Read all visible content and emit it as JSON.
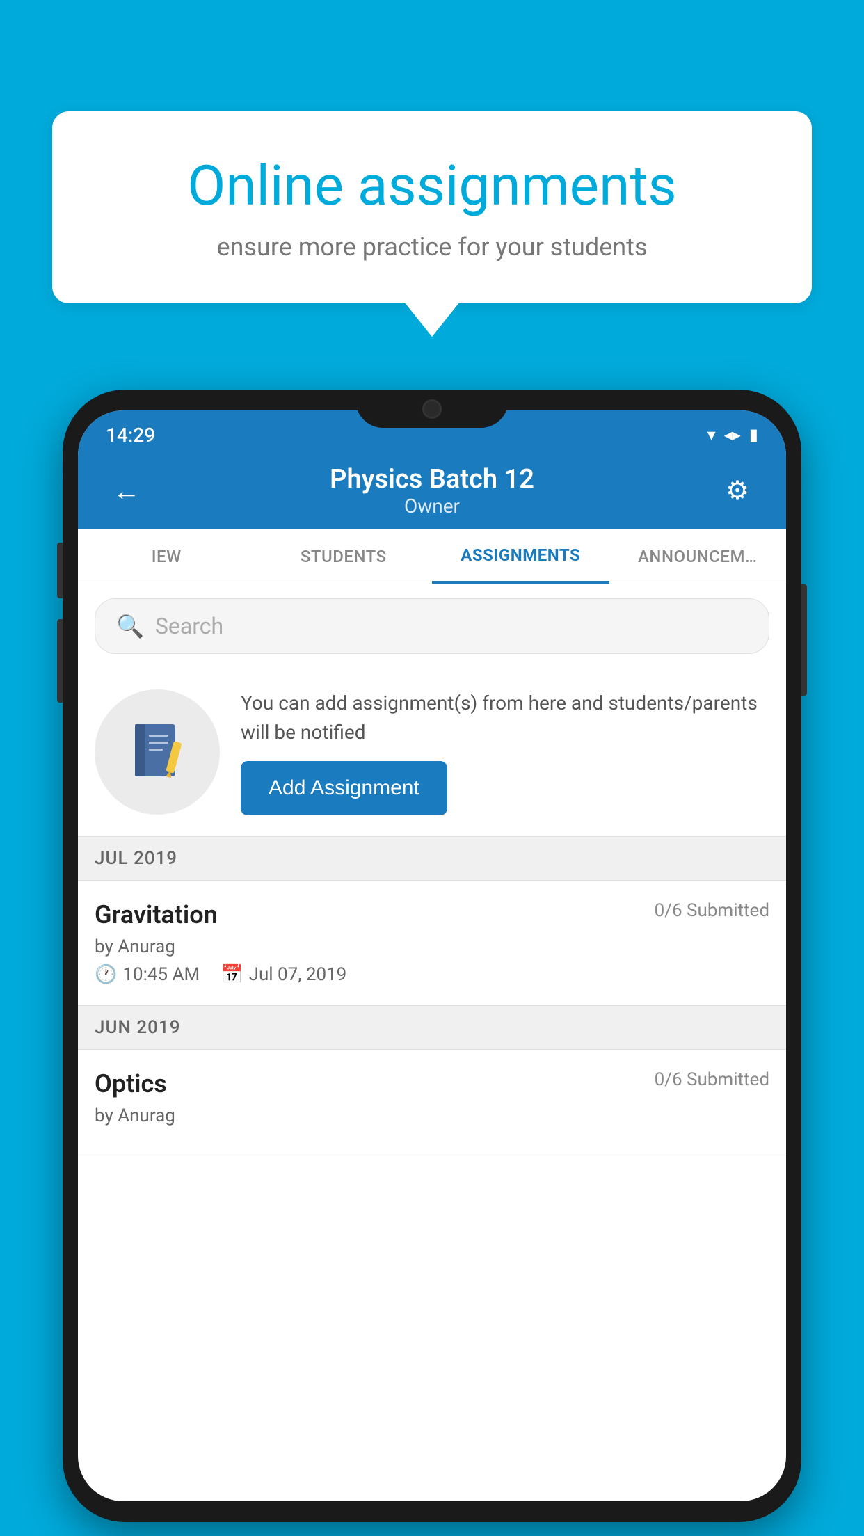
{
  "background_color": "#00AADB",
  "speech_bubble": {
    "title": "Online assignments",
    "subtitle": "ensure more practice for your students"
  },
  "status_bar": {
    "time": "14:29",
    "icons": [
      "wifi",
      "signal",
      "battery"
    ]
  },
  "header": {
    "title": "Physics Batch 12",
    "subtitle": "Owner",
    "back_label": "←",
    "settings_label": "⚙"
  },
  "tabs": [
    {
      "label": "IEW",
      "active": false
    },
    {
      "label": "STUDENTS",
      "active": false
    },
    {
      "label": "ASSIGNMENTS",
      "active": true
    },
    {
      "label": "ANNOUNCEM…",
      "active": false
    }
  ],
  "search": {
    "placeholder": "Search"
  },
  "assignment_prompt": {
    "text": "You can add assignment(s) from here and students/parents will be notified",
    "button_label": "Add Assignment"
  },
  "sections": [
    {
      "month": "JUL 2019",
      "assignments": [
        {
          "title": "Gravitation",
          "submitted": "0/6 Submitted",
          "author": "by Anurag",
          "time": "10:45 AM",
          "date": "Jul 07, 2019"
        }
      ]
    },
    {
      "month": "JUN 2019",
      "assignments": [
        {
          "title": "Optics",
          "submitted": "0/6 Submitted",
          "author": "by Anurag",
          "time": "",
          "date": ""
        }
      ]
    }
  ]
}
